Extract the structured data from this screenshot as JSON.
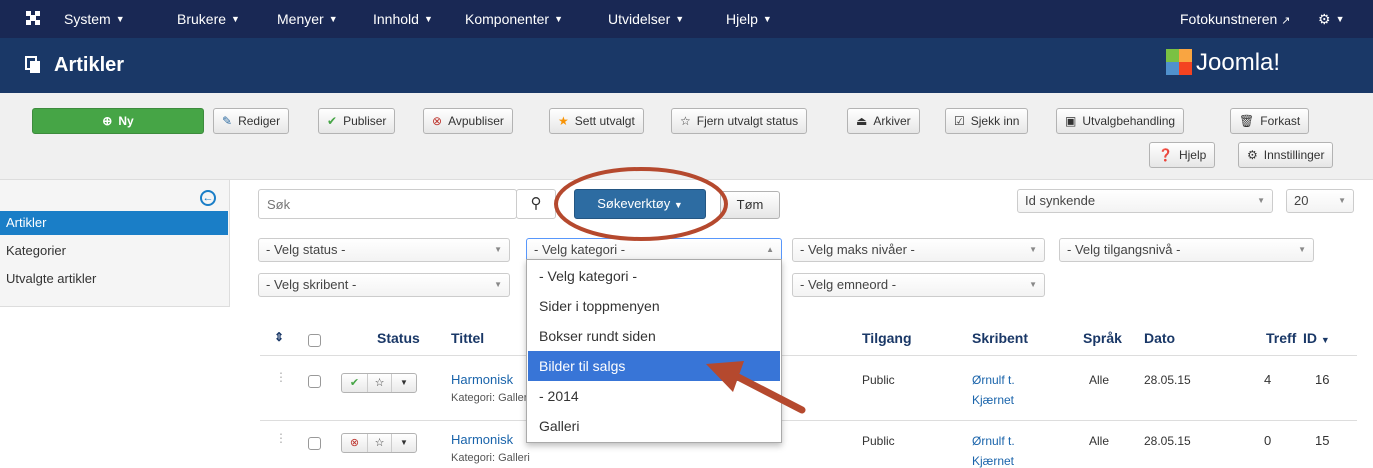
{
  "topbar": {
    "menus": [
      "System",
      "Brukere",
      "Menyer",
      "Innhold",
      "Komponenter",
      "Utvidelser",
      "Hjelp"
    ],
    "site_name": "Fotokunstneren",
    "logo_icon": "joomla-icon",
    "external_icon": "external-link-icon",
    "settings_icon": "gear-icon"
  },
  "header": {
    "title": "Artikler",
    "logo_text": "Joomla!"
  },
  "toolbar": {
    "new": "Ny",
    "edit": "Rediger",
    "publish": "Publiser",
    "unpublish": "Avpubliser",
    "feature": "Sett utvalgt",
    "unfeature": "Fjern utvalgt status",
    "archive": "Arkiver",
    "checkin": "Sjekk inn",
    "batch": "Utvalgbehandling",
    "trash": "Forkast",
    "help": "Hjelp",
    "options": "Innstillinger"
  },
  "sidebar": {
    "items": [
      "Artikler",
      "Kategorier",
      "Utvalgte artikler"
    ],
    "active": "Artikler"
  },
  "search": {
    "placeholder": "Søk",
    "tools_label": "Søkeverktøy",
    "clear_label": "Tøm",
    "sort_value": "Id synkende",
    "limit_value": "20"
  },
  "filters": {
    "status": "- Velg status -",
    "category": "- Velg kategori -",
    "max_level": "- Velg maks nivåer -",
    "access": "- Velg tilgangsnivå -",
    "author": "- Velg skribent -",
    "tag": "- Velg emneord -"
  },
  "category_dropdown": {
    "options": [
      "- Velg kategori -",
      "Sider i toppmenyen",
      "Bokser rundt siden",
      "Bilder til salgs",
      "- 2014",
      "Galleri"
    ],
    "highlighted": "Bilder til salgs"
  },
  "table": {
    "headers": {
      "status": "Status",
      "title": "Tittel",
      "access": "Tilgang",
      "author": "Skribent",
      "language": "Språk",
      "date": "Dato",
      "hits": "Treff",
      "id": "ID"
    },
    "rows": [
      {
        "title": "Harmonisk",
        "category": "Kategori: Galleri",
        "access": "Public",
        "author_line1": "Ørnulf t.",
        "author_line2": "Kjærnet",
        "language": "Alle",
        "date": "28.05.15",
        "hits": "4",
        "id": "16",
        "published": true
      },
      {
        "title": "Harmonisk",
        "category": "Kategori: Galleri",
        "access": "Public",
        "author_line1": "Ørnulf t.",
        "author_line2": "Kjærnet",
        "language": "Alle",
        "date": "28.05.15",
        "hits": "0",
        "id": "15",
        "published": false
      }
    ]
  },
  "colors": {
    "topbar": "#192854",
    "header": "#1a3867",
    "accent": "#1a7ec7",
    "new_button": "#46a546",
    "annotation": "#b5492e"
  }
}
